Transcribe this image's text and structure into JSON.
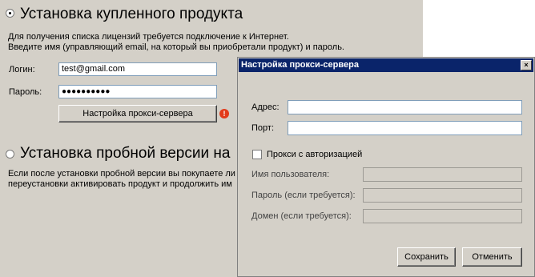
{
  "installer": {
    "section1": {
      "title": "Установка купленного продукта",
      "desc_line1": "Для получения списка лицензий требуется подключение к Интернет.",
      "desc_line2": "Введите имя (управляющий email, на который вы приобретали продукт) и пароль.",
      "login_label": "Логин:",
      "login_value": "test@gmail.com",
      "password_label": "Пароль:",
      "password_value": "●●●●●●●●●●",
      "proxy_button": "Настройка прокси-сервера",
      "warning_symbol": "!"
    },
    "section2": {
      "title": "Установка  пробной версии на",
      "desc_line1": "Если после установки пробной версии вы покупаете ли",
      "desc_line2": "переустановки активировать продукт и продолжить им"
    }
  },
  "proxy_dialog": {
    "title": "Настройка прокси-сервера",
    "close_symbol": "×",
    "address_label": "Адрес:",
    "address_value": "",
    "port_label": "Порт:",
    "port_value": "",
    "auth_checkbox_label": "Прокси с авторизацией",
    "auth_checked": false,
    "username_label": "Имя пользователя:",
    "pwd_label": "Пароль (если требуется):",
    "domain_label": "Домен (если требуется):",
    "save_button": "Сохранить",
    "cancel_button": "Отменить"
  },
  "colors": {
    "window_bg": "#d4d0c8",
    "title_bar": "#0a246a",
    "warning": "#e23b1b"
  }
}
